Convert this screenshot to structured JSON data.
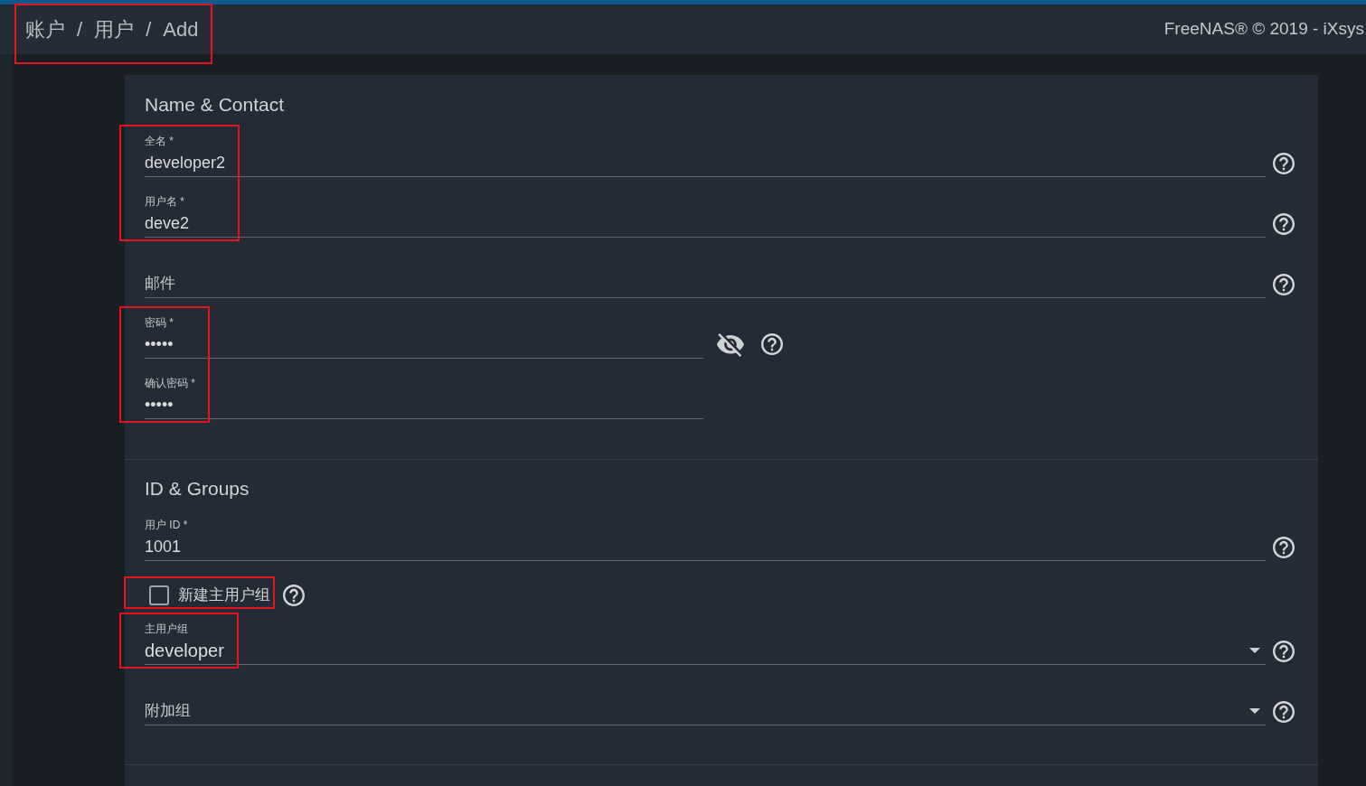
{
  "header": {
    "breadcrumb": {
      "highlighted": true,
      "items": [
        {
          "label": "账户"
        },
        {
          "label": "用户"
        },
        {
          "label": "Add"
        }
      ],
      "separators": [
        "/",
        "/"
      ]
    },
    "copyright": "FreeNAS® © 2019 - iXsys"
  },
  "sections": [
    {
      "title": "Name & Contact",
      "groups": [
        {
          "highlighted": true,
          "fields": [
            {
              "kind": "text",
              "label": "全名 *",
              "value": "developer2",
              "help": true
            },
            {
              "kind": "text",
              "label": "用户名 *",
              "value": "deve2",
              "help": true
            }
          ]
        },
        {
          "highlighted": false,
          "fields": [
            {
              "kind": "text",
              "placeholder": "邮件",
              "help": true
            }
          ]
        },
        {
          "highlighted": true,
          "fields": [
            {
              "kind": "password",
              "label": "密码 *",
              "value": "•••••",
              "reveal_toggle": true,
              "help": true
            },
            {
              "kind": "password",
              "label": "确认密码 *",
              "value": "•••••",
              "reveal_toggle": false,
              "help": false
            }
          ]
        }
      ]
    },
    {
      "title": "ID & Groups",
      "groups": [
        {
          "highlighted": false,
          "fields": [
            {
              "kind": "text",
              "label": "用户 ID *",
              "value": "1001",
              "help": true
            }
          ]
        },
        {
          "highlighted": true,
          "fields": [
            {
              "kind": "checkbox",
              "label": "新建主用户组",
              "checked": false,
              "help": true
            }
          ]
        },
        {
          "highlighted": true,
          "fields": [
            {
              "kind": "select",
              "label": "主用户组",
              "value": "developer",
              "help": true
            }
          ]
        },
        {
          "highlighted": false,
          "fields": [
            {
              "kind": "select",
              "placeholder": "附加组",
              "help": true
            }
          ]
        }
      ]
    }
  ]
}
